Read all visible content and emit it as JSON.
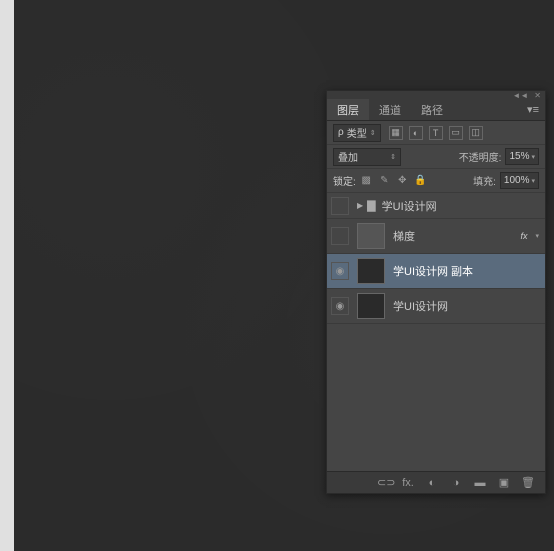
{
  "tabs": {
    "layers": "图层",
    "channels": "通道",
    "paths": "路径"
  },
  "filter": {
    "kind_label": "类型"
  },
  "blend": {
    "mode": "叠加",
    "opacity_label": "不透明度:",
    "opacity_value": "15%"
  },
  "lock": {
    "label": "锁定:",
    "fill_label": "填充:",
    "fill_value": "100%"
  },
  "layers": [
    {
      "name": "学UI设计网",
      "type": "group",
      "visible": false
    },
    {
      "name": "梯度",
      "type": "layer",
      "visible": false,
      "fx": "fx"
    },
    {
      "name": "学UI设计网 副本",
      "type": "layer",
      "visible": true,
      "selected": true
    },
    {
      "name": "学UI设计网",
      "type": "layer",
      "visible": true
    }
  ],
  "icons": {
    "search": "ρ",
    "link": "⊂⊃",
    "fx": "fx.",
    "mask": "◐",
    "adjust": "◑",
    "folder": "▬",
    "new": "▣",
    "trash": "🗑"
  }
}
